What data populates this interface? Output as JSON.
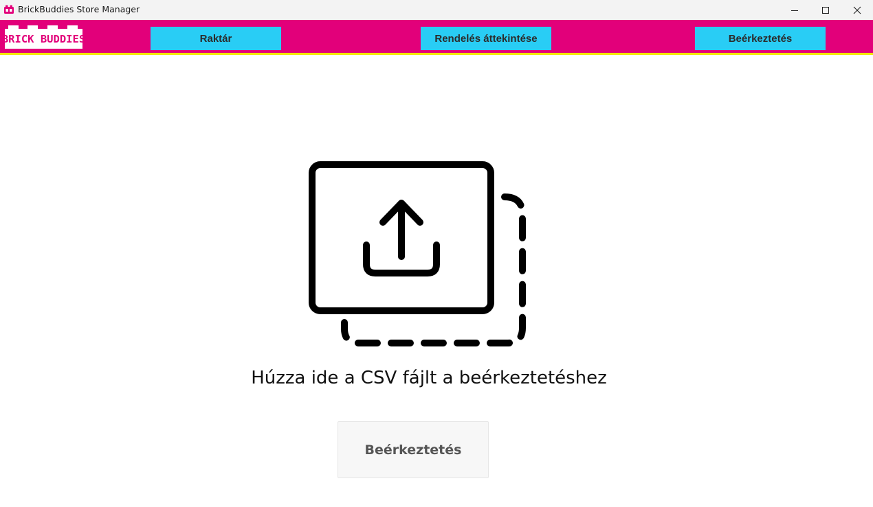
{
  "window": {
    "title": "BrickBuddies Store Manager",
    "icon": "brick-app-icon",
    "controls": [
      "minimize-icon",
      "maximize-icon",
      "close-icon"
    ]
  },
  "navbar": {
    "background": "#e2007a",
    "accent_line": "#f2e600",
    "logo_text": "BRICK BUDDIES",
    "items": [
      {
        "label": "Raktár"
      },
      {
        "label": "Rendelés áttekintése"
      },
      {
        "label": "Beérkeztetés"
      }
    ],
    "button_color": "#29cdf5"
  },
  "main": {
    "drop_icon": "upload-drop-icon",
    "drop_text": "Húzza ide a CSV fájlt a beérkeztetéshez",
    "action_button": "Beérkeztetés"
  }
}
